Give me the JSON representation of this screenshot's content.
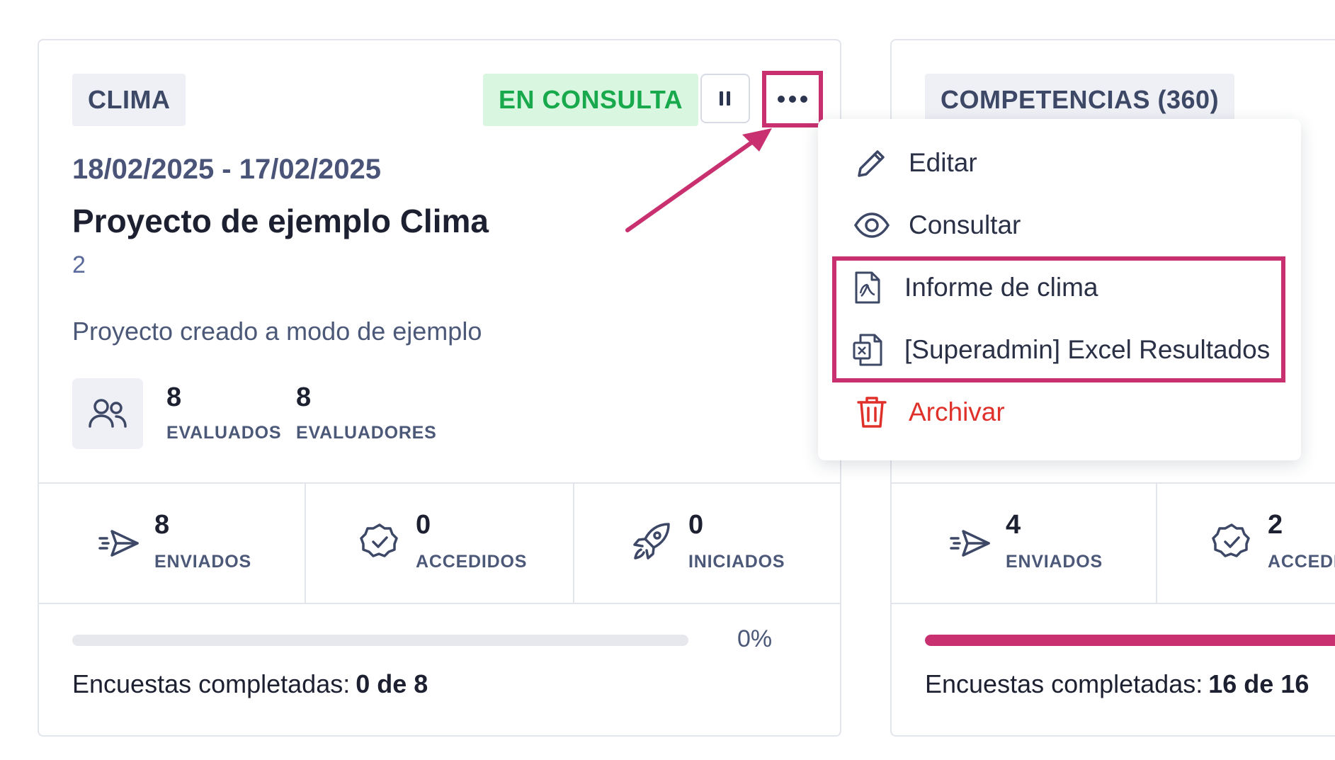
{
  "card1": {
    "tag": "CLIMA",
    "status": "EN CONSULTA",
    "dates": "18/02/2025 - 17/02/2025",
    "title": "Proyecto de ejemplo Clima",
    "code": "2",
    "description": "Proyecto creado a modo de ejemplo",
    "evaluados": {
      "value": "8",
      "label": "EVALUADOS"
    },
    "evaluadores": {
      "value": "8",
      "label": "EVALUADORES"
    },
    "stats": [
      {
        "icon": "send-icon",
        "value": "8",
        "label": "ENVIADOS"
      },
      {
        "icon": "badge-check-icon",
        "value": "0",
        "label": "ACCEDIDOS"
      },
      {
        "icon": "rocket-icon",
        "value": "0",
        "label": "INICIADOS"
      }
    ],
    "progress": {
      "fraction": 0.0,
      "percent_text": "0%"
    },
    "completed_label": "Encuestas completadas:",
    "completed_value": "0 de 8"
  },
  "card2": {
    "tag": "COMPETENCIAS (360)",
    "stats": [
      {
        "icon": "send-icon",
        "value": "4",
        "label": "ENVIADOS"
      },
      {
        "icon": "badge-check-icon",
        "value": "2",
        "label": "ACCEDI"
      }
    ],
    "progress": {
      "fraction": 1.0
    },
    "completed_label": "Encuestas completadas:",
    "completed_value": "16 de 16"
  },
  "menu": {
    "items": [
      {
        "icon": "pencil-icon",
        "label": "Editar"
      },
      {
        "icon": "eye-icon",
        "label": "Consultar"
      },
      {
        "icon": "pdf-file-icon",
        "label": "Informe de clima"
      },
      {
        "icon": "excel-file-icon",
        "label": "[Superadmin] Excel Resultados"
      },
      {
        "icon": "trash-icon",
        "label": "Archivar"
      }
    ]
  },
  "colors": {
    "accent": "#c8306f",
    "status_green_text": "#18a94d",
    "status_green_bg": "#d9f7e0",
    "danger": "#e0302a",
    "progress_fill": "#c8306f"
  }
}
